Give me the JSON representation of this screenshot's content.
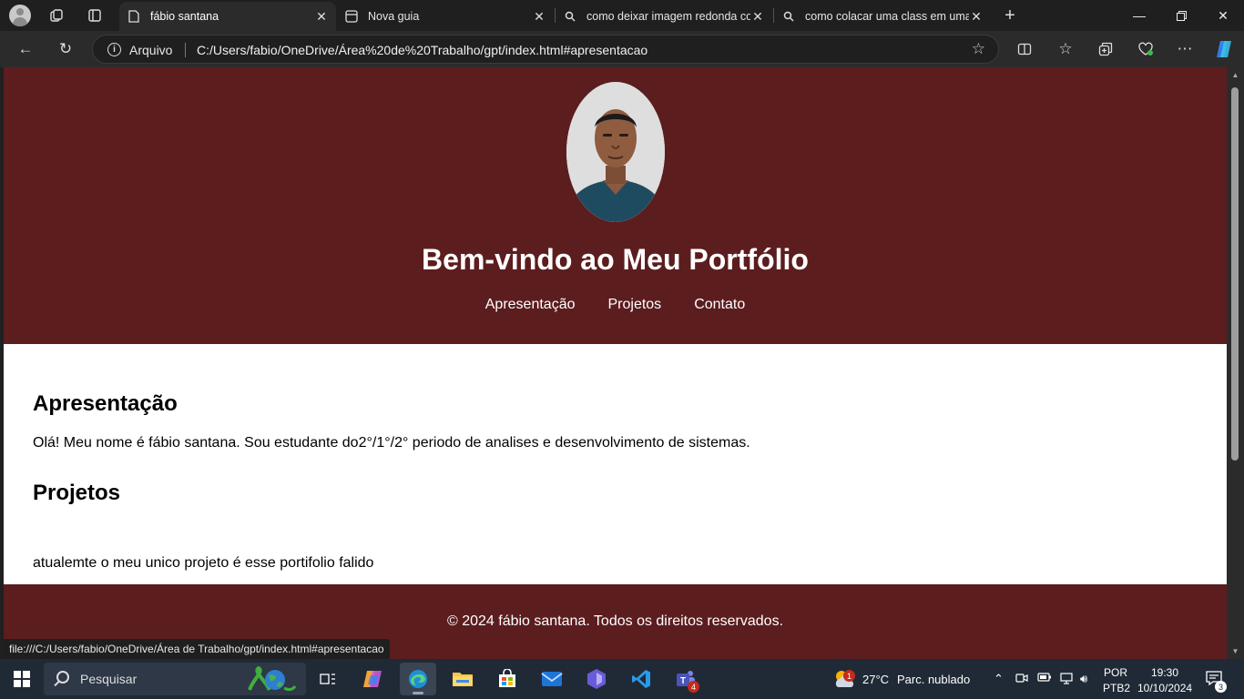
{
  "tabs": [
    {
      "title": "fábio santana",
      "icon": "page-icon",
      "active": true
    },
    {
      "title": "Nova guia",
      "icon": "newtab-icon",
      "active": false
    },
    {
      "title": "como deixar imagem redonda com",
      "icon": "search-icon",
      "active": false
    },
    {
      "title": "como colacar uma class em uma im",
      "icon": "search-icon",
      "active": false
    }
  ],
  "addressbar": {
    "scheme_label": "Arquivo",
    "url": "C:/Users/fabio/OneDrive/Área%20de%20Trabalho/gpt/index.html#apresentacao"
  },
  "site": {
    "title": "Bem-vindo ao Meu Portfólio",
    "nav": [
      "Apresentação",
      "Projetos",
      "Contato"
    ],
    "sections": [
      {
        "heading": "Apresentação",
        "text": "Olá! Meu nome é fábio santana. Sou estudante do2°/1°/2° periodo de analises e desenvolvimento de sistemas."
      },
      {
        "heading": "Projetos",
        "text": "atualemte o meu unico projeto é esse portifolio falido"
      }
    ],
    "footer": "© 2024 fábio santana. Todos os direitos reservados.",
    "colors": {
      "header_bg": "#5c1d1f",
      "footer_bg": "#5c1d1f",
      "text": "#ffffff"
    }
  },
  "status_bar": {
    "hover_url": "file:///C:/Users/fabio/OneDrive/Área de Trabalho/gpt/index.html#apresentacao"
  },
  "taskbar": {
    "search_placeholder": "Pesquisar",
    "weather_temp": "27°C",
    "weather_desc": "Parc. nublado",
    "weather_badge": "1",
    "lang": "POR",
    "layout": "PTB2",
    "time": "19:30",
    "date": "10/10/2024",
    "teams_badge": "4",
    "notifications_badge": "3"
  }
}
